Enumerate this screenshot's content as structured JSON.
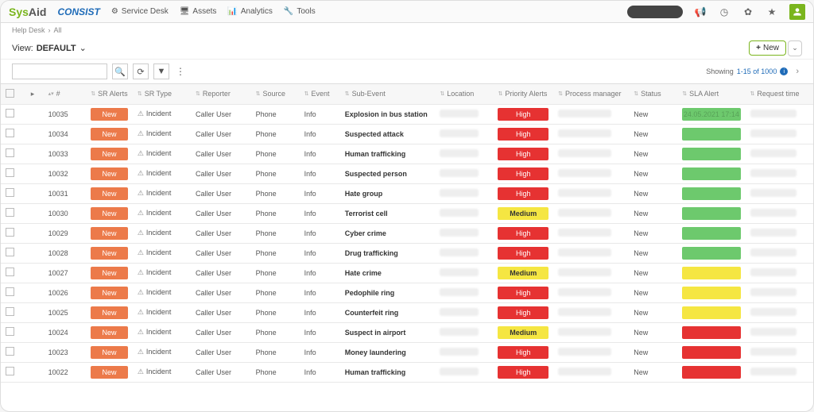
{
  "brand": {
    "logo1a": "Sys",
    "logo1b": "Aid",
    "logo2": "CONSIST"
  },
  "nav": [
    {
      "icon": "⚙",
      "label": "Service Desk"
    },
    {
      "icon": "🖥",
      "label": "Assets"
    },
    {
      "icon": "📊",
      "label": "Analytics"
    },
    {
      "icon": "🔧",
      "label": "Tools"
    }
  ],
  "breadcrumb": {
    "a": "Help Desk",
    "b": "All"
  },
  "view": {
    "prefix": "View:",
    "name": "DEFAULT"
  },
  "newbtn": "New",
  "showing": {
    "prefix": "Showing",
    "range": "1-15 of 1000"
  },
  "columns": [
    "",
    "",
    "#",
    "SR Alerts",
    "SR Type",
    "Reporter",
    "Source",
    "Event",
    "Sub-Event",
    "Location",
    "Priority Alerts",
    "Process manager",
    "Status",
    "SLA Alert",
    "Request time"
  ],
  "rows": [
    {
      "id": "10035",
      "sralert": "New",
      "srtype": "Incident",
      "reporter": "Caller User",
      "source": "Phone",
      "event": "Info",
      "subevent": "Explosion in bus station",
      "priority": "High",
      "status": "New",
      "sla": "green",
      "slatext": "24.05.2021 17:14"
    },
    {
      "id": "10034",
      "sralert": "New",
      "srtype": "Incident",
      "reporter": "Caller User",
      "source": "Phone",
      "event": "Info",
      "subevent": "Suspected attack",
      "priority": "High",
      "status": "New",
      "sla": "green"
    },
    {
      "id": "10033",
      "sralert": "New",
      "srtype": "Incident",
      "reporter": "Caller User",
      "source": "Phone",
      "event": "Info",
      "subevent": "Human trafficking",
      "priority": "High",
      "status": "New",
      "sla": "green"
    },
    {
      "id": "10032",
      "sralert": "New",
      "srtype": "Incident",
      "reporter": "Caller User",
      "source": "Phone",
      "event": "Info",
      "subevent": "Suspected person",
      "priority": "High",
      "status": "New",
      "sla": "green"
    },
    {
      "id": "10031",
      "sralert": "New",
      "srtype": "Incident",
      "reporter": "Caller User",
      "source": "Phone",
      "event": "Info",
      "subevent": "Hate group",
      "priority": "High",
      "status": "New",
      "sla": "green"
    },
    {
      "id": "10030",
      "sralert": "New",
      "srtype": "Incident",
      "reporter": "Caller User",
      "source": "Phone",
      "event": "Info",
      "subevent": "Terrorist cell",
      "priority": "Medium",
      "status": "New",
      "sla": "green"
    },
    {
      "id": "10029",
      "sralert": "New",
      "srtype": "Incident",
      "reporter": "Caller User",
      "source": "Phone",
      "event": "Info",
      "subevent": "Cyber crime",
      "priority": "High",
      "status": "New",
      "sla": "green"
    },
    {
      "id": "10028",
      "sralert": "New",
      "srtype": "Incident",
      "reporter": "Caller User",
      "source": "Phone",
      "event": "Info",
      "subevent": "Drug trafficking",
      "priority": "High",
      "status": "New",
      "sla": "green"
    },
    {
      "id": "10027",
      "sralert": "New",
      "srtype": "Incident",
      "reporter": "Caller User",
      "source": "Phone",
      "event": "Info",
      "subevent": "Hate crime",
      "priority": "Medium",
      "status": "New",
      "sla": "yellow"
    },
    {
      "id": "10026",
      "sralert": "New",
      "srtype": "Incident",
      "reporter": "Caller User",
      "source": "Phone",
      "event": "Info",
      "subevent": "Pedophile ring",
      "priority": "High",
      "status": "New",
      "sla": "yellow"
    },
    {
      "id": "10025",
      "sralert": "New",
      "srtype": "Incident",
      "reporter": "Caller User",
      "source": "Phone",
      "event": "Info",
      "subevent": "Counterfeit ring",
      "priority": "High",
      "status": "New",
      "sla": "yellow"
    },
    {
      "id": "10024",
      "sralert": "New",
      "srtype": "Incident",
      "reporter": "Caller User",
      "source": "Phone",
      "event": "Info",
      "subevent": "Suspect in airport",
      "priority": "Medium",
      "status": "New",
      "sla": "red"
    },
    {
      "id": "10023",
      "sralert": "New",
      "srtype": "Incident",
      "reporter": "Caller User",
      "source": "Phone",
      "event": "Info",
      "subevent": "Money laundering",
      "priority": "High",
      "status": "New",
      "sla": "red"
    },
    {
      "id": "10022",
      "sralert": "New",
      "srtype": "Incident",
      "reporter": "Caller User",
      "source": "Phone",
      "event": "Info",
      "subevent": "Human trafficking",
      "priority": "High",
      "status": "New",
      "sla": "red"
    }
  ]
}
